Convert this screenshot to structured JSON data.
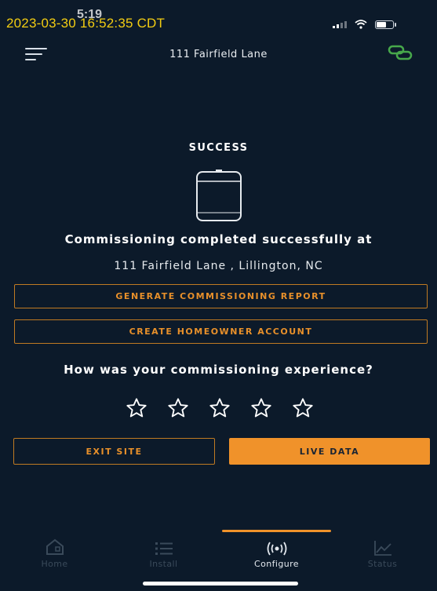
{
  "status_bar": {
    "timestamp_overlay": "2023-03-30 16:52:35 CDT",
    "time": "5:19"
  },
  "header": {
    "title": "111 Fairfield Lane",
    "link_color": "#47a84b"
  },
  "main": {
    "success_title": "SUCCESS",
    "completed_text": "Commissioning completed successfully at",
    "address_text": "111 Fairfield Lane , Lillington, NC",
    "generate_report_label": "GENERATE COMMISSIONING REPORT",
    "create_account_label": "CREATE HOMEOWNER ACCOUNT",
    "experience_question": "How was your commissioning experience?",
    "rating": {
      "max": 5,
      "selected": 0
    },
    "exit_site_label": "EXIT SITE",
    "live_data_label": "LIVE DATA"
  },
  "tab_bar": {
    "tabs": [
      {
        "label": "Home",
        "icon": "home-icon",
        "active": false
      },
      {
        "label": "Install",
        "icon": "list-icon",
        "active": false
      },
      {
        "label": "Configure",
        "icon": "broadcast-icon",
        "active": true
      },
      {
        "label": "Status",
        "icon": "chart-icon",
        "active": false
      }
    ]
  },
  "colors": {
    "background": "#0c1a2a",
    "accent": "#f0922a",
    "timestamp": "#f2cc12"
  }
}
